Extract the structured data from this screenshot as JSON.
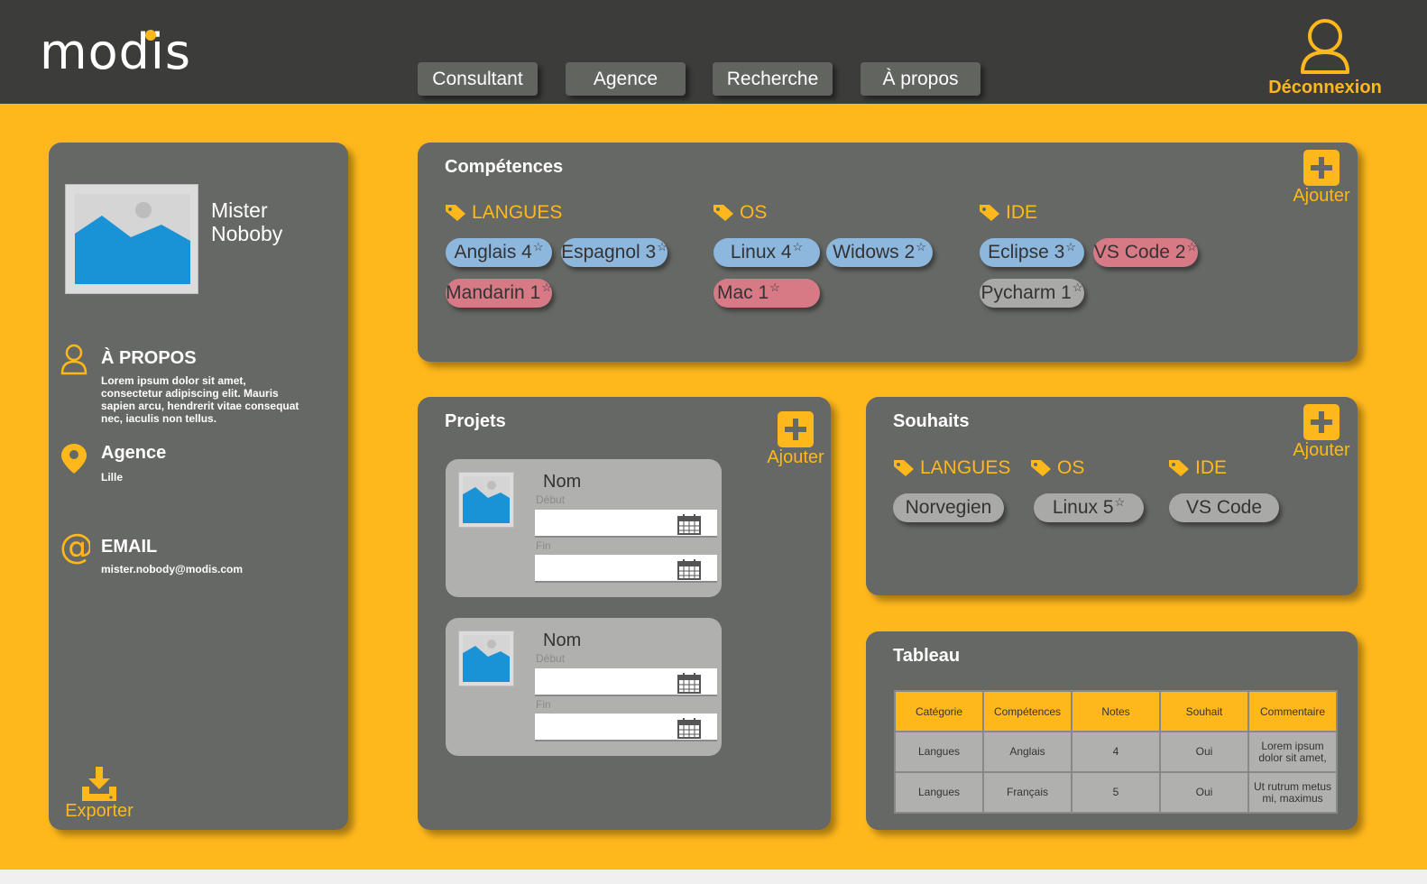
{
  "header": {
    "logo": "modis",
    "nav": [
      "Consultant",
      "Agence",
      "Recherche",
      "À propos"
    ],
    "logout_label": "Déconnexion",
    "icons": {
      "logout": "user-outline-icon"
    }
  },
  "colors": {
    "accent": "#ffb81c",
    "panel": "#666865",
    "topbar": "#3c3d3a",
    "chip_blue": "#8eb7dd",
    "chip_red": "#d77a86",
    "chip_gray": "#a9aaa7"
  },
  "profile": {
    "first_name": "Mister",
    "last_name": "Noboby",
    "about_title": "À PROPOS",
    "about_text": "Lorem ipsum dolor sit amet, consectetur adipiscing elit. Mauris sapien arcu, hendrerit vitae consequat nec, iaculis non tellus.",
    "agency_title": "Agence",
    "agency_value": "Lille",
    "email_title": "EMAIL",
    "email_value": "mister.nobody@modis.com",
    "export_label": "Exporter"
  },
  "competences": {
    "title": "Compétences",
    "add_label": "Ajouter",
    "categories": [
      {
        "name": "LANGUES",
        "chips": [
          {
            "label": "Anglais 4",
            "color": "blue"
          },
          {
            "label": "Espagnol 3",
            "color": "blue"
          },
          {
            "label": "Mandarin 1",
            "color": "red"
          }
        ]
      },
      {
        "name": "OS",
        "chips": [
          {
            "label": "Linux 4",
            "color": "blue"
          },
          {
            "label": "Widows 2",
            "color": "blue"
          },
          {
            "label": "Mac 1",
            "color": "red"
          }
        ]
      },
      {
        "name": "IDE",
        "chips": [
          {
            "label": "Eclipse 3",
            "color": "blue"
          },
          {
            "label": "VS Code 2",
            "color": "red"
          },
          {
            "label": "Pycharm 1",
            "color": "gray"
          }
        ]
      }
    ]
  },
  "projets": {
    "title": "Projets",
    "add_label": "Ajouter",
    "items": [
      {
        "name": "Nom",
        "start_label": "Début",
        "end_label": "Fin"
      },
      {
        "name": "Nom",
        "start_label": "Début",
        "end_label": "Fin"
      }
    ]
  },
  "souhaits": {
    "title": "Souhaits",
    "add_label": "Ajouter",
    "categories": [
      "LANGUES",
      "OS",
      "IDE"
    ],
    "chips": [
      "Norvegien",
      "Linux 5",
      "VS Code"
    ]
  },
  "tableau": {
    "title": "Tableau",
    "headers": [
      "Catégorie",
      "Compétences",
      "Notes",
      "Souhait",
      "Commentaire"
    ],
    "rows": [
      [
        "Langues",
        "Anglais",
        "4",
        "Oui",
        "Lorem ipsum dolor sit amet,"
      ],
      [
        "Langues",
        "Français",
        "5",
        "Oui",
        "Ut rutrum metus mi, maximus"
      ]
    ]
  }
}
